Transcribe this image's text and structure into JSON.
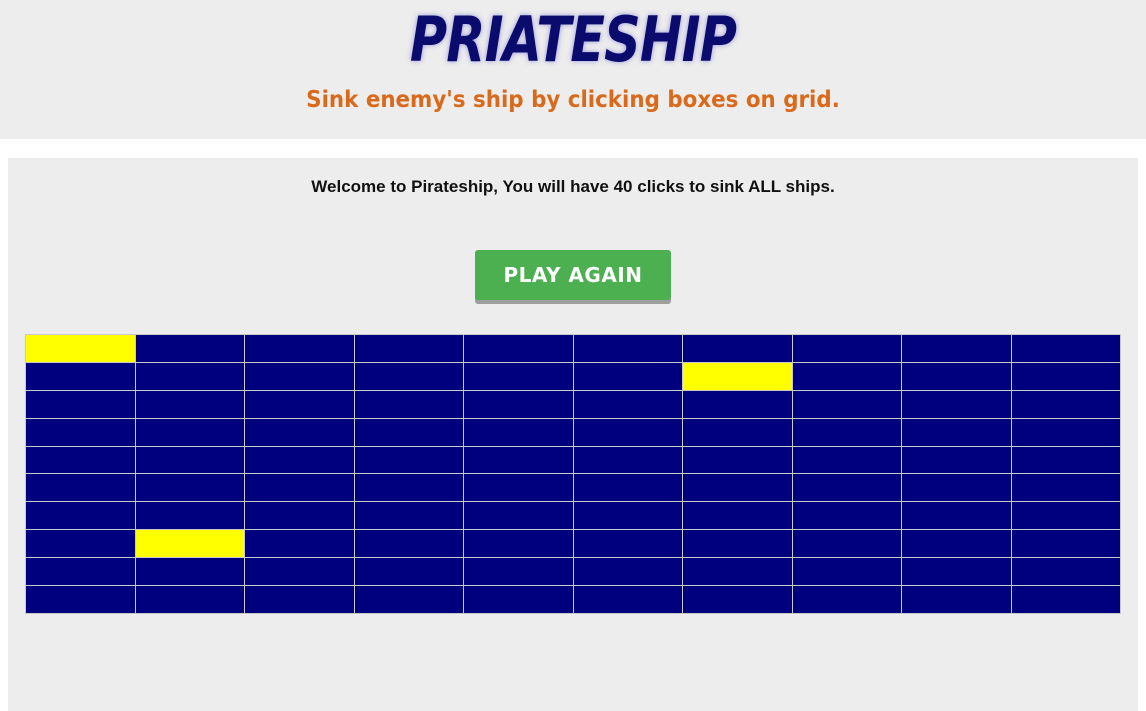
{
  "header": {
    "title": "PRIATESHIP",
    "subtitle": "Sink enemy's ship by clicking boxes on grid."
  },
  "game": {
    "welcome_text": "Welcome to Pirateship, You will have 40 clicks to sink ALL ships.",
    "play_again_label": "PLAY AGAIN",
    "grid": {
      "rows": 10,
      "cols": 10,
      "hit_cells": [
        {
          "row": 0,
          "col": 0
        },
        {
          "row": 1,
          "col": 6
        },
        {
          "row": 7,
          "col": 1
        }
      ]
    },
    "colors": {
      "water": "#00007f",
      "hit": "#ffff00",
      "button": "#4caf50",
      "title": "#0b0b6e",
      "subtitle": "#d96a1b"
    }
  }
}
